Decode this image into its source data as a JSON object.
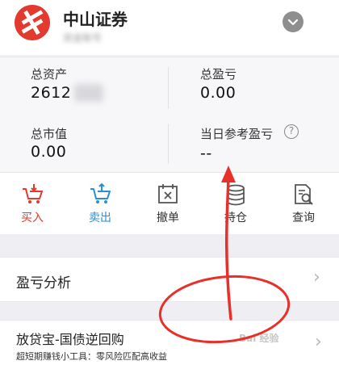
{
  "header": {
    "brand_name": "中山证券",
    "account_name": "资金账号"
  },
  "assets": {
    "total_assets_label": "总资产",
    "total_assets_value": "2612",
    "total_pnl_label": "总盈亏",
    "total_pnl_value": "0.00",
    "market_value_label": "总市值",
    "market_value_value": "0.00",
    "daily_pnl_label": "当日参考盈亏",
    "daily_pnl_value": "--",
    "help_glyph": "?"
  },
  "actions": [
    {
      "label": "买入",
      "icon": "cart-down-icon"
    },
    {
      "label": "卖出",
      "icon": "cart-up-icon"
    },
    {
      "label": "撤单",
      "icon": "cancel-order-icon"
    },
    {
      "label": "持仓",
      "icon": "coin-stack-icon"
    },
    {
      "label": "查询",
      "icon": "doc-search-icon"
    }
  ],
  "analysis": {
    "label": "盈亏分析"
  },
  "promo": {
    "title": "放贷宝-国债逆回购",
    "subtitle": "超短期赚钱小工具：零风险匹配高收益"
  },
  "watermark": {
    "text": "Bai 经验"
  },
  "colors": {
    "accent_red": "#e23a2e",
    "action_blue": "#2a8fd6",
    "annotation_red": "#e8302a"
  }
}
